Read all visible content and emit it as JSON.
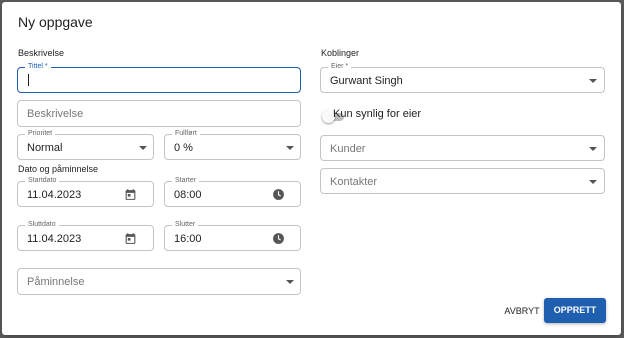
{
  "dialog": {
    "title": "Ny oppgave",
    "sections": {
      "description": "Beskrivelse",
      "date": "Dato og påminnelse",
      "links": "Koblinger"
    },
    "fields": {
      "title": {
        "label": "Tittel *",
        "value": ""
      },
      "description": {
        "placeholder": "Beskrivelse"
      },
      "priority": {
        "label": "Prioritet",
        "value": "Normal"
      },
      "completed": {
        "label": "Fullført",
        "value": "0 %"
      },
      "start_date": {
        "label": "Startdato",
        "value": "11.04.2023"
      },
      "start_time": {
        "label": "Starter",
        "value": "08:00"
      },
      "end_date": {
        "label": "Sluttdato",
        "value": "11.04.2023"
      },
      "end_time": {
        "label": "Slutter",
        "value": "16:00"
      },
      "reminder": {
        "placeholder": "Påminnelse"
      },
      "owner": {
        "label": "Eier *",
        "value": "Gurwant Singh"
      },
      "owner_only": {
        "label": "Kun synlig for eier",
        "on": false
      },
      "customers": {
        "placeholder": "Kunder"
      },
      "contacts": {
        "placeholder": "Kontakter"
      }
    },
    "buttons": {
      "cancel": "AVBRYT",
      "create": "OPPRETT"
    }
  },
  "colors": {
    "accent": "#1f5fb0",
    "border": "#c4c4c4",
    "backdrop": "#5e5e5e"
  },
  "icons": {
    "calendar": "calendar-icon",
    "clock": "clock-icon",
    "dropdown": "chevron-down-icon"
  }
}
